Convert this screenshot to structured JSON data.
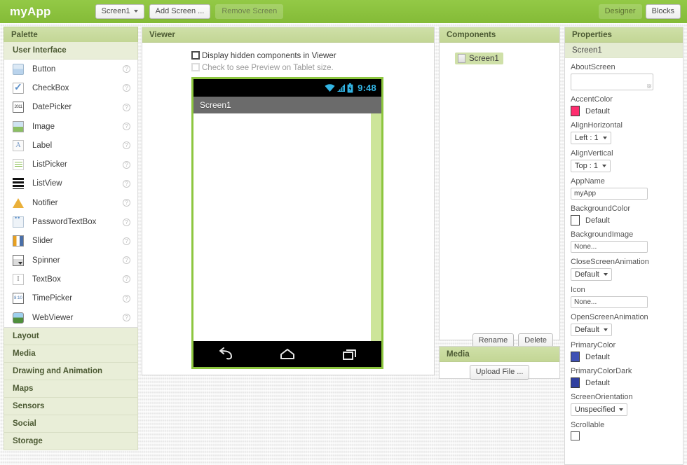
{
  "topbar": {
    "app_title": "myApp",
    "screen_selector": "Screen1",
    "add_screen": "Add Screen ...",
    "remove_screen": "Remove Screen",
    "designer": "Designer",
    "blocks": "Blocks",
    "accent_green": "#8ac13e"
  },
  "palette": {
    "title": "Palette",
    "open_category": "User Interface",
    "help_glyph": "?",
    "items": [
      {
        "label": "Button",
        "icon": "button-icon"
      },
      {
        "label": "CheckBox",
        "icon": "checkbox-icon"
      },
      {
        "label": "DatePicker",
        "icon": "datepicker-icon",
        "glyph": "2011"
      },
      {
        "label": "Image",
        "icon": "image-icon"
      },
      {
        "label": "Label",
        "icon": "label-icon",
        "glyph": "A"
      },
      {
        "label": "ListPicker",
        "icon": "listpicker-icon"
      },
      {
        "label": "ListView",
        "icon": "listview-icon"
      },
      {
        "label": "Notifier",
        "icon": "notifier-icon"
      },
      {
        "label": "PasswordTextBox",
        "icon": "passwordtextbox-icon"
      },
      {
        "label": "Slider",
        "icon": "slider-icon"
      },
      {
        "label": "Spinner",
        "icon": "spinner-icon"
      },
      {
        "label": "TextBox",
        "icon": "textbox-icon",
        "glyph": "I"
      },
      {
        "label": "TimePicker",
        "icon": "timepicker-icon",
        "glyph": "8:10"
      },
      {
        "label": "WebViewer",
        "icon": "webviewer-icon"
      }
    ],
    "categories": [
      "Layout",
      "Media",
      "Drawing and Animation",
      "Maps",
      "Sensors",
      "Social",
      "Storage"
    ]
  },
  "viewer": {
    "title": "Viewer",
    "checkbox_hidden": "Display hidden components in Viewer",
    "checkbox_tablet": "Check to see Preview on Tablet size.",
    "phone": {
      "clock": "9:48",
      "screen_title": "Screen1",
      "status_icons": [
        "wifi-icon",
        "signal-icon",
        "battery-icon"
      ],
      "nav_icons": [
        "back-icon",
        "home-icon",
        "recents-icon"
      ],
      "border_color": "#8dc63f",
      "status_icon_color": "#33b5e5"
    }
  },
  "components": {
    "title": "Components",
    "tree": [
      {
        "label": "Screen1",
        "icon": "screen-icon",
        "selected": true
      }
    ],
    "rename": "Rename",
    "delete": "Delete"
  },
  "media": {
    "title": "Media",
    "upload": "Upload File ..."
  },
  "properties": {
    "title": "Properties",
    "subject": "Screen1",
    "rows": [
      {
        "name": "AboutScreen",
        "kind": "textarea",
        "value": ""
      },
      {
        "name": "AccentColor",
        "kind": "color",
        "value": "Default",
        "color": "#ff2d6f"
      },
      {
        "name": "AlignHorizontal",
        "kind": "select",
        "value": "Left : 1"
      },
      {
        "name": "AlignVertical",
        "kind": "select",
        "value": "Top : 1"
      },
      {
        "name": "AppName",
        "kind": "text",
        "value": "myApp"
      },
      {
        "name": "BackgroundColor",
        "kind": "color",
        "value": "Default",
        "color": "#ffffff"
      },
      {
        "name": "BackgroundImage",
        "kind": "text",
        "value": "None..."
      },
      {
        "name": "CloseScreenAnimation",
        "kind": "select",
        "value": "Default"
      },
      {
        "name": "Icon",
        "kind": "text",
        "value": "None..."
      },
      {
        "name": "OpenScreenAnimation",
        "kind": "select",
        "value": "Default"
      },
      {
        "name": "PrimaryColor",
        "kind": "color",
        "value": "Default",
        "color": "#3f51b5"
      },
      {
        "name": "PrimaryColorDark",
        "kind": "color",
        "value": "Default",
        "color": "#303f9f"
      },
      {
        "name": "ScreenOrientation",
        "kind": "select",
        "value": "Unspecified"
      },
      {
        "name": "Scrollable",
        "kind": "checkbox",
        "value": ""
      }
    ]
  }
}
